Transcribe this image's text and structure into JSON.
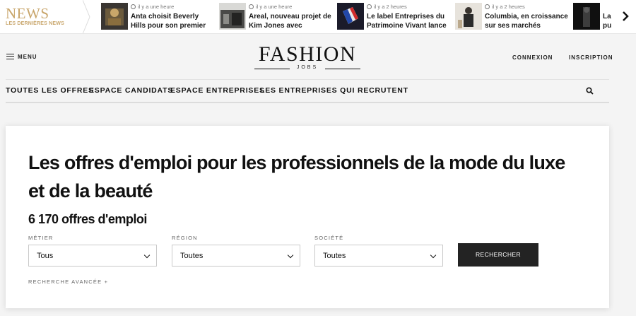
{
  "ticker": {
    "badge_title": "NEWS",
    "badge_subtitle": "LES DERNIÈRES NEWS",
    "items": [
      {
        "time": "il y a une heure",
        "title": "Anta choisit Beverly Hills pour son premier flagship..."
      },
      {
        "time": "il y a une heure",
        "title": "Areal, nouveau projet de Kim Jones avec Bosideng, mise..."
      },
      {
        "time": "il y a 2 heures",
        "title": "Le label Entreprises du Patrimoine Vivant lance un..."
      },
      {
        "time": "il y a 2 heures",
        "title": "Columbia, en croissance sur ses marchés internationau..."
      },
      {
        "time": "",
        "title": "La pu"
      }
    ],
    "next_icon": "chevron-right-icon"
  },
  "header": {
    "menu_label": "MENU",
    "logo_word": "FASHION",
    "logo_sub": "JOBS",
    "login": "CONNEXION",
    "register": "INSCRIPTION"
  },
  "nav": {
    "items": [
      "TOUTES LES OFFRES",
      "ESPACE CANDIDATS",
      "ESPACE ENTREPRISES",
      "LES ENTREPRISES QUI RECRUTENT"
    ],
    "search_icon": "search-icon"
  },
  "search": {
    "heading": "Les offres d'emploi pour les professionnels de la mode du luxe et de la beauté",
    "count": "6 170 offres d'emploi",
    "fields": [
      {
        "label": "MÉTIER",
        "value": "Tous"
      },
      {
        "label": "RÉGION",
        "value": "Toutes"
      },
      {
        "label": "SOCIÉTÉ",
        "value": "Toutes"
      }
    ],
    "submit": "RECHERCHER",
    "advanced": "RECHERCHE AVANCÉE +"
  },
  "colors": {
    "accent_gold": "#c8a56a",
    "button_dark": "#232323",
    "background": "#f4f4f4"
  }
}
